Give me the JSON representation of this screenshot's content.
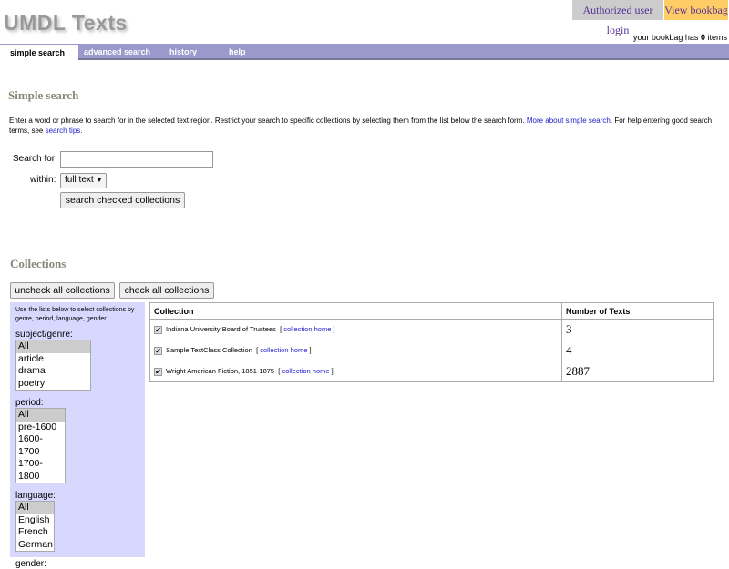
{
  "header": {
    "logo": "UMDL Texts",
    "login": "Authorized user login",
    "bookbag": "View bookbag",
    "bookbag_prefix": "your bookbag has",
    "bookbag_count": "0",
    "bookbag_suffix": "items"
  },
  "tabs": [
    "simple search",
    "advanced search",
    "history",
    "help"
  ],
  "search": {
    "heading": "Simple search",
    "intro_1": "Enter a word or phrase to search for in the selected text region. Restrict your search to specific collections by selecting them from the list below the search form.",
    "intro_link1": "More about simple search",
    "intro_2": ". For help entering good search terms, see",
    "intro_link2": "search tips",
    "intro_3": ".",
    "search_for_label": "Search for:",
    "search_value": "",
    "within_label": "within:",
    "within_value": "full text",
    "submit": "search checked collections"
  },
  "collections": {
    "heading": "Collections",
    "uncheck_all": "uncheck all collections",
    "check_all": "check all collections",
    "sidebar": {
      "help": "Use the lists below to select collections by genre, period, language, gender.",
      "lists": [
        {
          "label": "subject/genre:",
          "options": [
            "All",
            "article",
            "drama",
            "poetry"
          ]
        },
        {
          "label": "period:",
          "options": [
            "All",
            "pre-1600",
            "1600-1700",
            "1700-1800"
          ]
        },
        {
          "label": "language:",
          "options": [
            "All",
            "English",
            "French",
            "German"
          ]
        },
        {
          "label": "gender:"
        }
      ]
    },
    "table": {
      "headers": [
        "Collection",
        "Number of Texts"
      ],
      "link_label": "collection home",
      "rows": [
        {
          "name": "Indiana University Board of Trustees",
          "count": "3",
          "checked": true
        },
        {
          "name": "Sample TextClass Collection",
          "count": "4",
          "checked": true
        },
        {
          "name": "Wright American Fiction, 1851-1875",
          "count": "2887",
          "checked": true
        }
      ]
    }
  }
}
